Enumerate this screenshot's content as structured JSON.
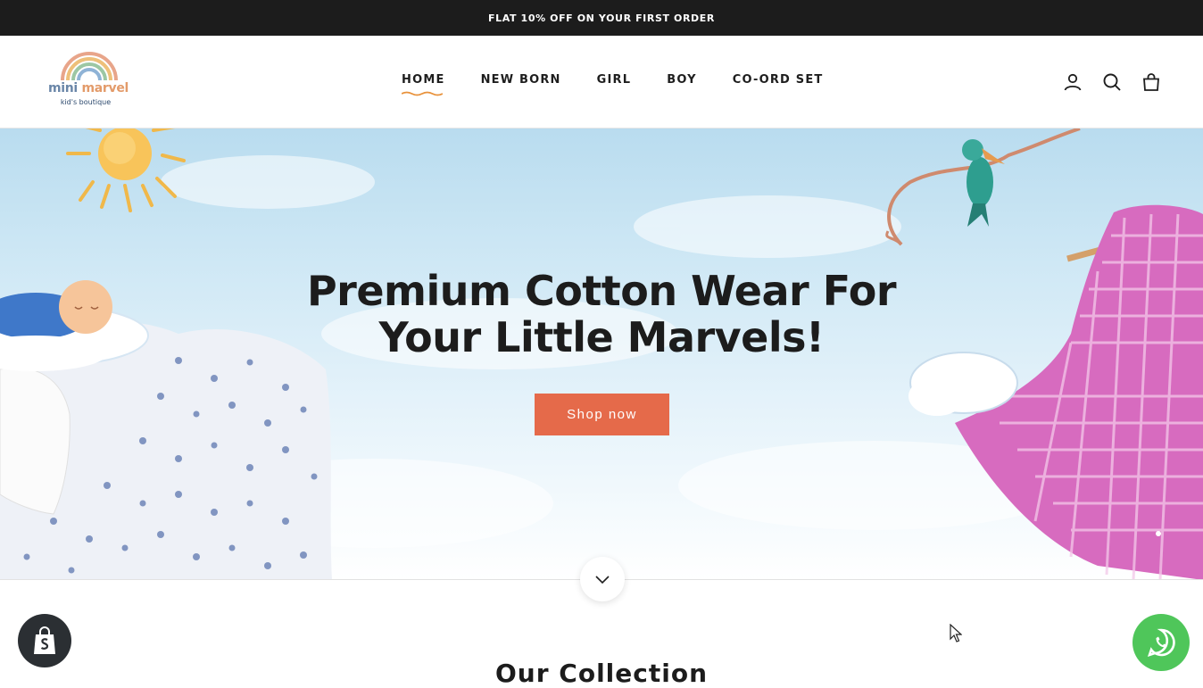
{
  "announcement": {
    "text": "FLAT 10% OFF ON YOUR FIRST ORDER"
  },
  "header": {
    "logo": {
      "name_part1": "mini",
      "name_part2": "marvel",
      "tagline": "kid's boutique"
    },
    "nav": [
      {
        "label": "HOME",
        "active": true
      },
      {
        "label": "NEW BORN"
      },
      {
        "label": "GIRL"
      },
      {
        "label": "BOY"
      },
      {
        "label": "CO-ORD SET"
      }
    ],
    "icons": [
      "account-icon",
      "search-icon",
      "cart-icon"
    ]
  },
  "hero": {
    "title_line1": "Premium Cotton Wear For",
    "title_line2": "Your Little Marvels!",
    "cta_label": "Shop now"
  },
  "collection": {
    "title": "Our Collection"
  },
  "colors": {
    "cta": "#e56a4a",
    "announcement_bg": "#1c1c1c",
    "whatsapp": "#4fc65a",
    "accent_underline": "#e8913a"
  }
}
